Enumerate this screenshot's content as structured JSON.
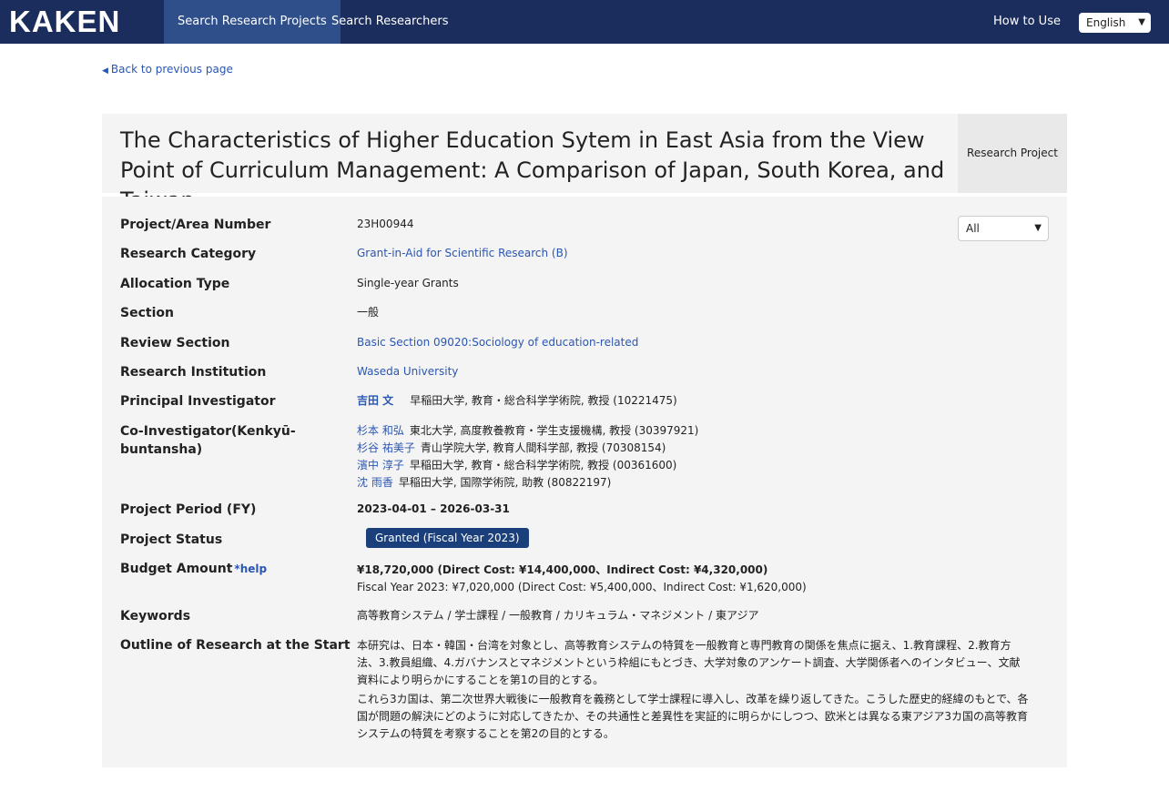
{
  "nav": {
    "logo": "KAKEN",
    "tabs": [
      "Search Research Projects",
      "Search Researchers"
    ],
    "how_to_use": "How to Use",
    "language": "English"
  },
  "back_link": "Back to previous page",
  "project": {
    "title": "The Characteristics of Higher Education Sytem in East Asia from the View Point of Curriculum Management: A Comparison of Japan, South Korea, and Taiwan",
    "type": "Research Project"
  },
  "filter": {
    "selected": "All"
  },
  "fields": {
    "number": {
      "label": "Project/Area Number",
      "value": "23H00944"
    },
    "category": {
      "label": "Research Category",
      "value": "Grant-in-Aid for Scientific Research (B)"
    },
    "allocation": {
      "label": "Allocation Type",
      "value": "Single-year Grants"
    },
    "section": {
      "label": "Section",
      "value": "一般"
    },
    "review": {
      "label": "Review Section",
      "value": "Basic Section 09020:Sociology of education-related"
    },
    "institution": {
      "label": "Research Institution",
      "value": "Waseda University"
    },
    "pi": {
      "label": "Principal Investigator",
      "name": "吉田 文",
      "affiliation": "早稲田大学, 教育・総合科学学術院, 教授 (10221475)"
    },
    "co": {
      "label": "Co-Investigator(Kenkyū-buntansha)",
      "members": [
        {
          "name": "杉本 和弘",
          "affiliation": "東北大学, 高度教養教育・学生支援機構, 教授 (30397921)"
        },
        {
          "name": "杉谷 祐美子",
          "affiliation": "青山学院大学, 教育人間科学部, 教授 (70308154)"
        },
        {
          "name": "濱中 淳子",
          "affiliation": "早稲田大学, 教育・総合科学学術院, 教授 (00361600)"
        },
        {
          "name": "沈 雨香",
          "affiliation": "早稲田大学, 国際学術院, 助教 (80822197)"
        }
      ]
    },
    "period": {
      "label": "Project Period (FY)",
      "value": "2023-04-01 – 2026-03-31"
    },
    "status": {
      "label": "Project Status",
      "value": "Granted (Fiscal Year 2023)"
    },
    "budget": {
      "label": "Budget Amount",
      "help": "*help",
      "total": "¥18,720,000 (Direct Cost: ¥14,400,000、Indirect Cost: ¥4,320,000)",
      "fy": "Fiscal Year 2023: ¥7,020,000 (Direct Cost: ¥5,400,000、Indirect Cost: ¥1,620,000)"
    },
    "keywords": {
      "label": "Keywords",
      "value": "高等教育システム / 学士課程 / 一般教育 / カリキュラム・マネジメント / 東アジア"
    },
    "outline": {
      "label": "Outline of Research at the Start",
      "p1": "本研究は、日本・韓国・台湾を対象とし、高等教育システムの特質を一般教育と専門教育の関係を焦点に据え、1.教育課程、2.教育方法、3.教員組織、4.ガバナンスとマネジメントという枠組にもとづき、大学対象のアンケート調査、大学関係者へのインタビュー、文献資料により明らかにすることを第1の目的とする。",
      "p2": "これら3カ国は、第二次世界大戦後に一般教育を義務として学士課程に導入し、改革を繰り返してきた。こうした歴史的経緯のもとで、各国が問題の解決にどのように対応してきたか、その共通性と差異性を実証的に明らかにしつつ、欧米とは異なる東アジア3カ国の高等教育システムの特質を考察することを第2の目的とする。"
    }
  }
}
